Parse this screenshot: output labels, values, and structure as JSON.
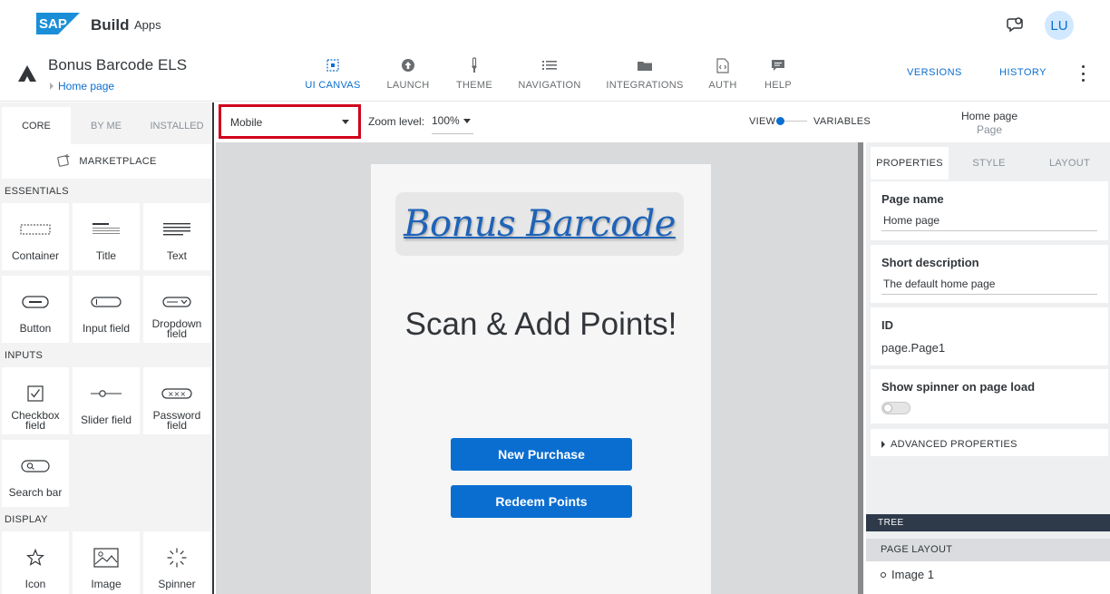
{
  "header": {
    "logo_text": "SAP",
    "product": "Build",
    "product_sub": "Apps",
    "avatar_initials": "LU",
    "app_name": "Bonus Barcode ELS",
    "breadcrumb": "Home page",
    "tabs": [
      {
        "label": "UI CANVAS",
        "icon": "ui-canvas-icon",
        "active": true
      },
      {
        "label": "LAUNCH",
        "icon": "upload-icon",
        "active": false
      },
      {
        "label": "THEME",
        "icon": "brush-icon",
        "active": false
      },
      {
        "label": "NAVIGATION",
        "icon": "list-icon",
        "active": false
      },
      {
        "label": "INTEGRATIONS",
        "icon": "folder-icon",
        "active": false
      },
      {
        "label": "AUTH",
        "icon": "auth-document-icon",
        "active": false
      },
      {
        "label": "HELP",
        "icon": "chat-icon",
        "active": false
      }
    ],
    "versions_label": "VERSIONS",
    "history_label": "HISTORY"
  },
  "left_panel": {
    "tabs": [
      "CORE",
      "BY ME",
      "INSTALLED"
    ],
    "active_tab": "CORE",
    "marketplace_label": "MARKETPLACE",
    "sections": {
      "essentials": "ESSENTIALS",
      "inputs": "INPUTS",
      "display": "DISPLAY"
    },
    "components": {
      "container": "Container",
      "title": "Title",
      "text": "Text",
      "button": "Button",
      "input_field": "Input field",
      "dropdown_field": "Dropdown field",
      "checkbox_field": "Checkbox field",
      "slider_field": "Slider field",
      "password_field": "Password field",
      "search_bar": "Search bar",
      "icon": "Icon",
      "image": "Image",
      "spinner": "Spinner"
    }
  },
  "toolbar": {
    "device": "Mobile",
    "zoom_label": "Zoom level:",
    "zoom_value": "100%",
    "view_label": "VIEW",
    "variables_label": "VARIABLES",
    "page_title": "Home page",
    "page_subtitle": "Page"
  },
  "canvas": {
    "image_text": "Bonus Barcode",
    "heading": "Scan & Add Points!",
    "buttons": [
      "New Purchase",
      "Redeem Points"
    ]
  },
  "right_panel": {
    "tabs": [
      "PROPERTIES",
      "STYLE",
      "LAYOUT"
    ],
    "active_tab": "PROPERTIES",
    "page_name_label": "Page name",
    "page_name_value": "Home page",
    "short_desc_label": "Short description",
    "short_desc_value": "The default home page",
    "id_label": "ID",
    "id_value": "page.Page1",
    "spinner_label": "Show spinner on page load",
    "spinner_on": false,
    "advanced_label": "ADVANCED PROPERTIES",
    "tree_label": "TREE",
    "page_layout_label": "PAGE LAYOUT",
    "tree_items": [
      "Image 1"
    ]
  },
  "colors": {
    "accent": "#0a6ed1",
    "highlight_border": "#d0021b",
    "canvas_bg": "#d9dadb",
    "tree_header": "#2e3a4a"
  }
}
